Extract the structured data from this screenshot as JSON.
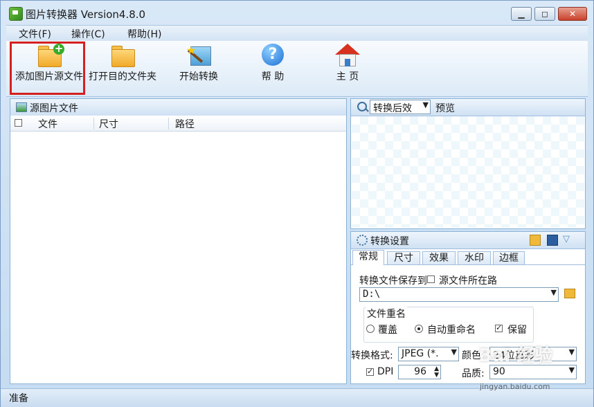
{
  "window": {
    "title": "图片转换器 Version4.8.0"
  },
  "window_buttons": {
    "minimize": "▁",
    "maximize": "◻",
    "close": "✕"
  },
  "menu": {
    "file": "文件(F)",
    "operate": "操作(C)",
    "help": "帮助(H)"
  },
  "toolbar": {
    "add_source": "添加图片源文件",
    "open_target": "打开目的文件夹",
    "start_convert": "开始转换",
    "help": "帮 助",
    "home": "主 页"
  },
  "source_panel": {
    "title": "源图片文件",
    "columns": [
      "文件",
      "尺寸",
      "路径"
    ]
  },
  "preview_panel": {
    "mode": "转换后效",
    "preview_label": "预览"
  },
  "settings_panel": {
    "title": "转换设置",
    "tabs": [
      "常规",
      "尺寸",
      "效果",
      "水印",
      "边框"
    ],
    "save_location_label": "转换文件保存到",
    "source_dir_label": "源文件所在路",
    "save_path": "D:\\",
    "rename_group": "文件重名",
    "overwrite": "覆盖",
    "auto_rename": "自动重命名",
    "keep": "保留",
    "format_label": "转换格式:",
    "format_value": "JPEG (*.",
    "color_label": "颜色:",
    "color_value": "24位真彩",
    "dpi_label": "DPI",
    "dpi_value": "96",
    "quality_label": "品质:",
    "quality_value": "90"
  },
  "status": {
    "text": "准备"
  },
  "watermark": {
    "text": "Bai 经验",
    "url": "jingyan.baidu.com"
  }
}
